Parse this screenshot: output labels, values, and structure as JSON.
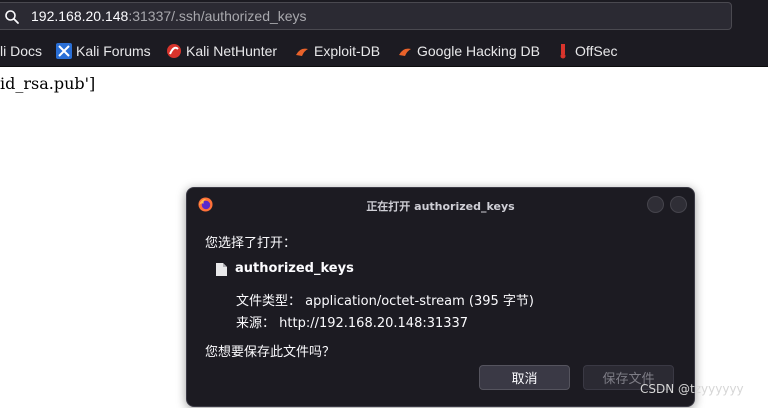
{
  "address_bar": {
    "host": "192.168.20.148",
    "rest": ":31337/.ssh/authorized_keys"
  },
  "bookmarks": [
    {
      "label": "li Docs",
      "icon": "kali-docs-icon"
    },
    {
      "label": "Kali Forums",
      "icon": "kali-forums-icon"
    },
    {
      "label": "Kali NetHunter",
      "icon": "kali-nethunter-icon"
    },
    {
      "label": "Exploit-DB",
      "icon": "exploit-db-icon"
    },
    {
      "label": "Google Hacking DB",
      "icon": "google-hacking-db-icon"
    },
    {
      "label": "OffSec",
      "icon": "offsec-icon"
    }
  ],
  "page": {
    "text": "id_rsa.pub']"
  },
  "dialog": {
    "title": "正在打开 authorized_keys",
    "intro": "您选择了打开：",
    "file_name": "authorized_keys",
    "type_line": "文件类型： application/octet-stream (395 字节)",
    "source_line": "来源： http://192.168.20.148:31337",
    "question": "您想要保存此文件吗？",
    "cancel_label": "取消",
    "save_label": "保存文件"
  },
  "watermark": "CSDN @tzyyyyyy",
  "colors": {
    "chrome_bg": "#1c1b22",
    "urlbar_bg": "#2b2a33",
    "dialog_bg": "#1c1b22",
    "text_light": "#fbfbfe"
  }
}
